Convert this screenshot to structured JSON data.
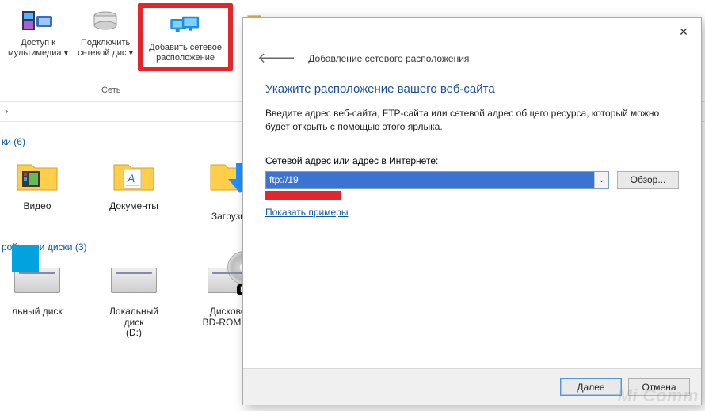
{
  "ribbon": {
    "media_access": {
      "line1": "Доступ к",
      "line2": "мультимедиа"
    },
    "connect_drive": {
      "line1": "Подключить",
      "line2": "сетевой дис"
    },
    "add_location": {
      "line1": "Добавить сетевое",
      "line2": "расположение"
    },
    "section_label": "Сеть"
  },
  "groups": {
    "folders": {
      "header": "ки (6)",
      "items": [
        {
          "label": "Видео"
        },
        {
          "label": "Документы"
        },
        {
          "label": "Загрузки"
        }
      ]
    },
    "devices": {
      "header": "ройства и диски (3)",
      "items": [
        {
          "label": "льный диск"
        },
        {
          "label1": "Локальный диск",
          "label2": "(D:)"
        },
        {
          "label1": "Дисковод",
          "label2": "BD-ROM (F:)"
        }
      ]
    }
  },
  "dialog": {
    "header": "Добавление сетевого расположения",
    "title": "Укажите расположение вашего веб-сайта",
    "description": "Введите адрес веб-сайта, FTP-сайта или сетевой адрес общего ресурса, который можно будет открыть с помощью этого ярлыка.",
    "field_label": "Сетевой адрес или адрес в Интернете:",
    "address_value": "ftp://19",
    "browse": "Обзор...",
    "examples_link": "Показать примеры",
    "next": "Далее",
    "cancel": "Отмена"
  },
  "watermark": "Mi Comm"
}
